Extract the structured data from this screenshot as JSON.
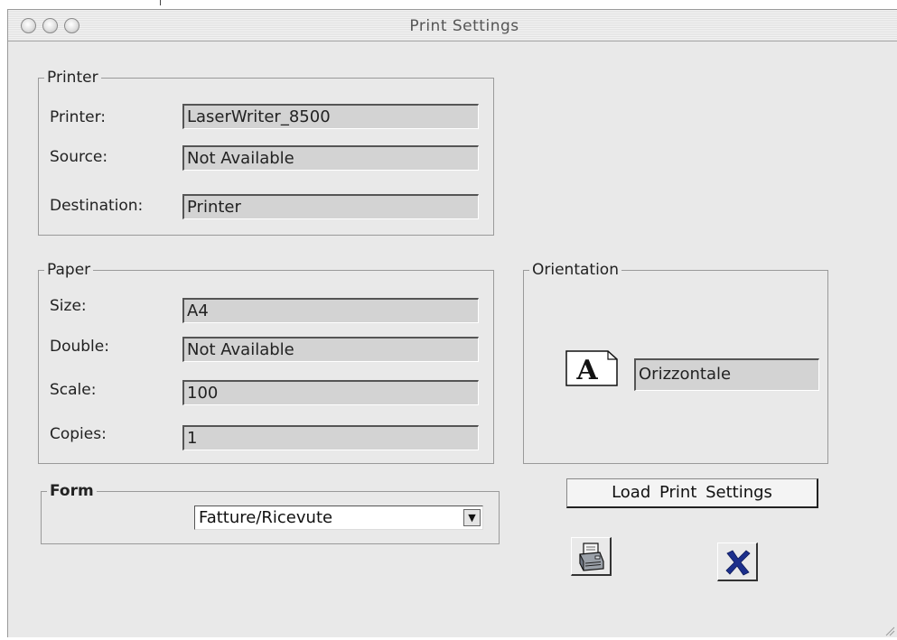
{
  "window": {
    "title": "Print Settings"
  },
  "printer_group": {
    "legend": "Printer",
    "printer_label": "Printer:",
    "printer_value": "LaserWriter_8500",
    "source_label": "Source:",
    "source_value": "Not Available",
    "destination_label": "Destination:",
    "destination_value": "Printer"
  },
  "paper_group": {
    "legend": "Paper",
    "size_label": "Size:",
    "size_value": "A4",
    "double_label": "Double:",
    "double_value": "Not Available",
    "scale_label": "Scale:",
    "scale_value": "100",
    "copies_label": "Copies:",
    "copies_value": "1"
  },
  "orientation_group": {
    "legend": "Orientation",
    "icon": "page-orientation-icon",
    "icon_glyph": "A",
    "value": "Orizzontale"
  },
  "form_group": {
    "legend": "Form",
    "selected": "Fatture/Ricevute"
  },
  "buttons": {
    "load_settings": "Load Print Settings",
    "print_icon": "printer-icon",
    "cancel_icon": "close-x-icon"
  },
  "colors": {
    "window_bg": "#e9e9e9",
    "field_bg": "#d3d3d3",
    "cancel_x": "#1c2f8c"
  }
}
